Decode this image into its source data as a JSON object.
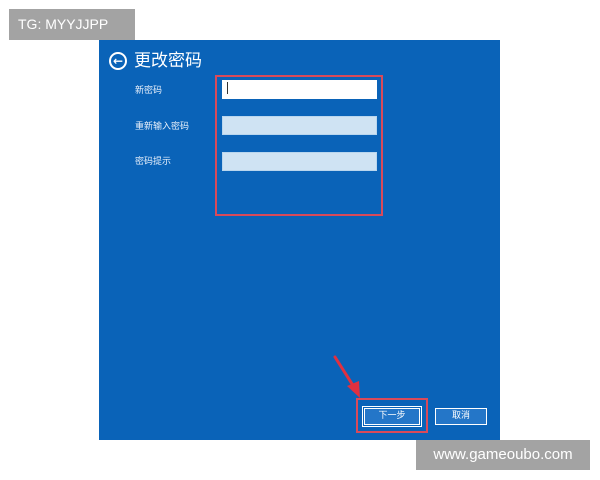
{
  "dialog": {
    "title": "更改密码",
    "fields": [
      {
        "label": "新密码",
        "value": ""
      },
      {
        "label": "重新输入密码",
        "value": ""
      },
      {
        "label": "密码提示",
        "value": ""
      }
    ],
    "next_label": "下一步",
    "cancel_label": "取消"
  },
  "watermarks": {
    "top_left": "TG: MYYJJPP",
    "bottom_right": "www.gameoubo.com"
  },
  "colors": {
    "panel_bg": "#0a63b8",
    "highlight": "#d94a5a",
    "watermark_bg": "#a3a3a3"
  },
  "icons": {
    "back": "back-arrow-circle-icon",
    "annotation": "red-arrow-annotation"
  }
}
